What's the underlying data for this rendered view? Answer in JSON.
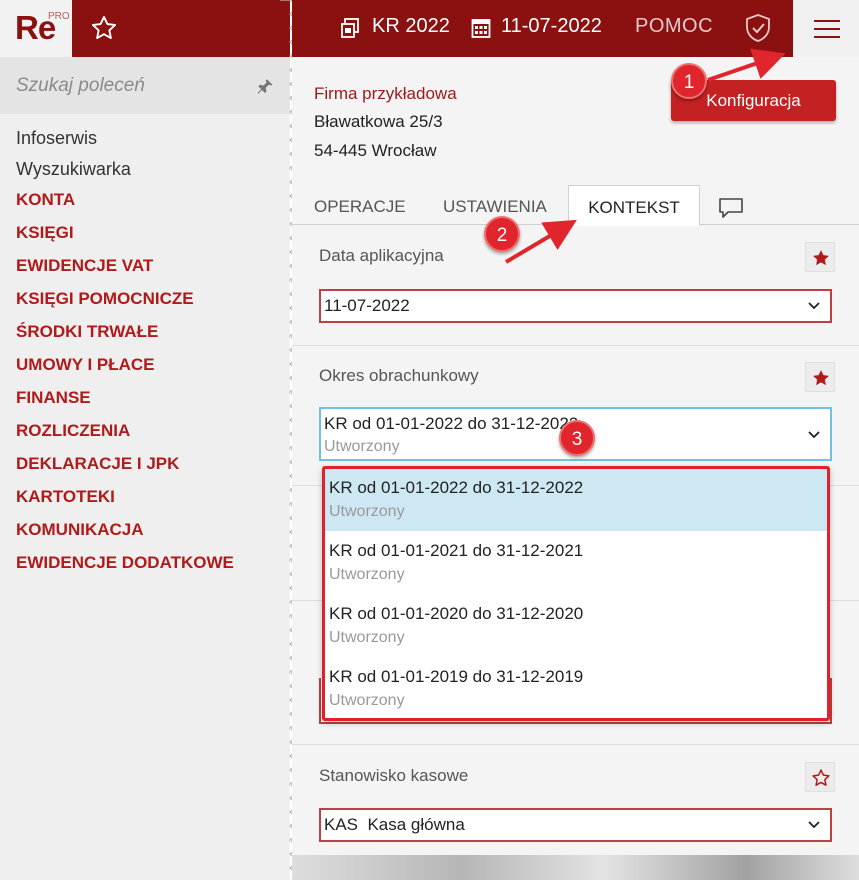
{
  "app": {
    "logo_text": "Re",
    "logo_superscript": "PRO"
  },
  "search": {
    "placeholder": "Szukaj poleceń"
  },
  "sidebar": {
    "plain_items": [
      {
        "label": "Infoserwis"
      },
      {
        "label": "Wyszukiwarka"
      }
    ],
    "items": [
      {
        "label": "KONTA"
      },
      {
        "label": "KSIĘGI"
      },
      {
        "label": "EWIDENCJE VAT"
      },
      {
        "label": "KSIĘGI POMOCNICZE"
      },
      {
        "label": "ŚRODKI TRWAŁE"
      },
      {
        "label": "UMOWY I PŁACE"
      },
      {
        "label": "FINANSE"
      },
      {
        "label": "ROZLICZENIA"
      },
      {
        "label": "DEKLARACJE I JPK"
      },
      {
        "label": "KARTOTEKI"
      },
      {
        "label": "KOMUNIKACJA"
      },
      {
        "label": "EWIDENCJE DODATKOWE"
      }
    ]
  },
  "topbar": {
    "period": "KR 2022",
    "date": "11-07-2022",
    "help": "POMOC"
  },
  "company": {
    "name": "Firma przykładowa",
    "street": "Bławatkowa 25/3",
    "city": "54-445 Wrocław"
  },
  "config_button": "Konfiguracja",
  "tabs": [
    {
      "label": "OPERACJE"
    },
    {
      "label": "USTAWIENIA"
    },
    {
      "label": "KONTEKST"
    }
  ],
  "sections": {
    "data_aplikacyjna": {
      "label": "Data aplikacyjna",
      "value": "11-07-2022"
    },
    "okres": {
      "label": "Okres obrachunkowy",
      "value": "KR od 01-01-2022 do 31-12-2022",
      "status": "Utworzony"
    },
    "stanowisko": {
      "label": "Stanowisko kasowe",
      "value": "KAS  Kasa główna"
    }
  },
  "dropdown_options": [
    {
      "label": "KR od 01-01-2022 do 31-12-2022",
      "status": "Utworzony"
    },
    {
      "label": "KR od 01-01-2021 do 31-12-2021",
      "status": "Utworzony"
    },
    {
      "label": "KR od 01-01-2020 do 31-12-2020",
      "status": "Utworzony"
    },
    {
      "label": "KR od 01-01-2019 do 31-12-2019",
      "status": "Utworzony"
    }
  ],
  "annotations": [
    {
      "number": "1"
    },
    {
      "number": "2"
    },
    {
      "number": "3"
    }
  ],
  "colors": {
    "brand": "#8b1111",
    "accent": "#c42222",
    "highlight": "#e0252c",
    "selected_row": "#cde8f3"
  }
}
